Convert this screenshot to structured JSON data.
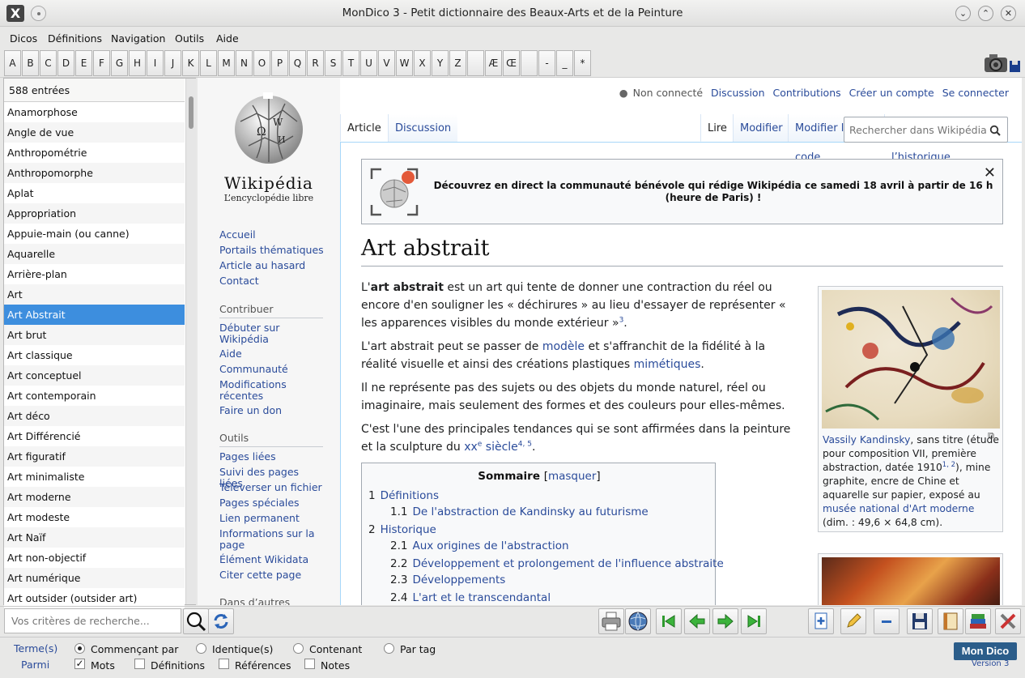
{
  "window": {
    "title": "MonDico 3 - Petit dictionnaire des Beaux-Arts et de la Peinture",
    "app_icon": "X"
  },
  "menu": [
    "Dicos",
    "Définitions",
    "Navigation",
    "Outils",
    "Aide"
  ],
  "letters": [
    "A",
    "B",
    "C",
    "D",
    "E",
    "F",
    "G",
    "H",
    "I",
    "J",
    "K",
    "L",
    "M",
    "N",
    "O",
    "P",
    "Q",
    "R",
    "S",
    "T",
    "U",
    "V",
    "W",
    "X",
    "Y",
    "Z",
    "",
    "Æ",
    "Œ",
    "",
    "-",
    "_",
    "*"
  ],
  "sidebar": {
    "count": "588 entrées",
    "entries": [
      "Anamorphose",
      "Angle de vue",
      "Anthropométrie",
      "Anthropomorphe",
      "Aplat",
      "Appropriation",
      "Appuie-main (ou canne)",
      "Aquarelle",
      "Arrière-plan",
      "Art",
      "Art Abstrait",
      "Art brut",
      "Art classique",
      "Art conceptuel",
      "Art contemporain",
      "Art déco",
      "Art Différencié",
      "Art figuratif",
      "Art minimaliste",
      "Art moderne",
      "Art modeste",
      "Art Naïf",
      "Art non-objectif",
      "Art numérique",
      "Art outsider (outsider art)"
    ],
    "selected": 10
  },
  "wiki": {
    "logo_name": "Wikipédia",
    "logo_tagline": "L’encyclopédie libre",
    "nav": [
      "Accueil",
      "Portails thématiques",
      "Article au hasard",
      "Contact"
    ],
    "contribute_title": "Contribuer",
    "contribute": [
      "Débuter sur Wikipédia",
      "Aide",
      "Communauté",
      "Modifications récentes",
      "Faire un don"
    ],
    "tools_title": "Outils",
    "tools": [
      "Pages liées",
      "Suivi des pages liées",
      "Téléverser un fichier",
      "Pages spéciales",
      "Lien permanent",
      "Informations sur la page",
      "Élément Wikidata",
      "Citer cette page"
    ],
    "other_projects_title": "Dans d’autres projets",
    "user": {
      "status": "Non connecté",
      "links": [
        "Discussion",
        "Contributions",
        "Créer un compte",
        "Se connecter"
      ]
    },
    "tabs_left": [
      "Article",
      "Discussion"
    ],
    "tabs_right": [
      "Lire",
      "Modifier",
      "Modifier le code",
      "Voir l’historique"
    ],
    "search_placeholder": "Rechercher dans Wikipédia",
    "banner": "Découvrez en direct la communauté bénévole qui rédige Wikipédia ce samedi 18 avril à partir de 16 h (heure de Paris) !",
    "title": "Art abstrait",
    "para1": {
      "a": "L'",
      "b": "art abstrait",
      "c": " est un art qui tente de donner une contraction du réel ou encore d'en souligner les « déchirures » au lieu d'essayer de représenter « les apparences visibles du monde extérieur »",
      "sup": "3",
      "d": "."
    },
    "para2": {
      "a": "L'art abstrait peut se passer de ",
      "link1": "modèle",
      "b": " et s'affranchit de la fidélité à la réalité visuelle et ainsi des créations plastiques ",
      "link2": "mimétiques",
      "c": "."
    },
    "para3": "Il ne représente pas des sujets ou des objets du monde naturel, réel ou imaginaire, mais seulement des formes et des couleurs pour elles-mêmes.",
    "para4": {
      "a": "C'est l'une des principales tendances qui se sont affirmées dans la peinture et la sculpture du ",
      "link": "xx",
      "sup_e": "e",
      "link_b": " siècle",
      "sup": "4, 5",
      "b": "."
    },
    "caption": {
      "link1": "Vassily Kandinsky",
      "a": ", sans titre (étude pour composition VII, première abstraction, datée 1910",
      "sup": "1, 2",
      "b": "), mine graphite, encre de Chine et aquarelle sur papier, exposé au ",
      "link2": "musée national d'Art moderne",
      "c": " (dim. : 49,6 × 64,8 cm)."
    },
    "toc": {
      "title": "Sommaire",
      "toggle": "masquer",
      "items": [
        {
          "num": "1",
          "text": "Définitions",
          "level": 1
        },
        {
          "num": "1.1",
          "text": "De l'abstraction de Kandinsky au futurisme",
          "level": 2
        },
        {
          "num": "2",
          "text": "Historique",
          "level": 1
        },
        {
          "num": "2.1",
          "text": "Aux origines de l'abstraction",
          "level": 2
        },
        {
          "num": "2.2",
          "text": "Développement et prolongement de l'influence abstraite",
          "level": 2
        },
        {
          "num": "2.3",
          "text": "Développements",
          "level": 2
        },
        {
          "num": "2.4",
          "text": "L'art et le transcendantal",
          "level": 2
        }
      ]
    }
  },
  "search": {
    "placeholder": "Vos critères de recherche..."
  },
  "filters": {
    "terms_label": "Terme(s)",
    "among_label": "Parmi",
    "modes": [
      "Commençant par",
      "Identique(s)",
      "Contenant",
      "Par tag"
    ],
    "mode_selected": 0,
    "fields": [
      "Mots",
      "Définitions",
      "Références",
      "Notes"
    ],
    "fields_checked": [
      true,
      false,
      false,
      false
    ]
  },
  "brand": {
    "name": "Mon Dico",
    "version": "Version 3"
  }
}
